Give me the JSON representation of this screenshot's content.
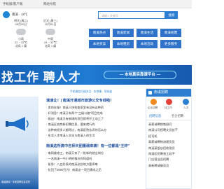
{
  "topbar": {
    "left": "手机版/客户端",
    "nav": "网站导航"
  },
  "header": {
    "city": "南溪 · 18℃",
    "search_placeholder": "请输入关键字",
    "search_button": "搜索"
  },
  "weather": [
    {
      "day": "明天 (周二)",
      "date": "09月30日",
      "cond": "小雨",
      "temp": "22 ~ 32℃",
      "wind": "北风 1 级"
    },
    {
      "day": "后天 (周三)",
      "date": "10月01日",
      "cond": "中雨",
      "temp": "24 ~ 32℃",
      "wind": "北风 1 级"
    }
  ],
  "nav": [
    "南溪热点",
    "南溪新闻",
    "南溪生活",
    "南溪招聘",
    "本地买卖",
    "本地租房",
    "本地活动",
    "更多服务"
  ],
  "banner": {
    "title": "找工作 聘人才",
    "subtitle": "— 本地真实靠谱平台 —"
  },
  "links_bar": "手机微信扫描关注  ·  本地事 · 早知道",
  "promo": {
    "caption": "南溪新闻 · 本地招聘信息发布"
  },
  "news": [
    {
      "title": "速速让！| 南溪开通城市旅游公交专线啦！",
      "items": [
        "· 男的在服！南溪人快检查家里有没有这种药",
        "· 好消息！南溪又有两个“三级公路”项目完成",
        "· 刚出！南溪又有新增的项目即将开工动工了",
        "· 南溪区农商新招聘信息，要来就行的",
        "· 这种病很多人都得过，南溪医院告诉你怎么办",
        "· 东北人才南溪人文化与南溪人的生活"
      ]
    },
    {
      "title": "南溪这所高中名师天团重磅来袭！有一位都是“王炸”",
      "items": [
        "· 电网维修工，南溪又来了一批新的就业岗位",
        "· 一名南溪一中小明的情况你知道吗",
        "· 紧急！八五阶段的南溪这些地方要停电",
        "· 拉回了5000万元！南溪这一项目建成之后"
      ]
    }
  ],
  "right_panel": {
    "title": "南溪招聘",
    "quick": [
      "企业招聘",
      "找工作",
      "人才"
    ],
    "tabs": [
      "招聘信息",
      "名企招聘"
    ],
    "jobs": [
      "高薪诚聘销售顾问",
      "南溪公司招聘文员若干",
      "招司机",
      "高薪诚聘物流理货员",
      "南溪某饭店招收银员",
      "南溪区招聘普工若干",
      "门店营业员招聘",
      "高新聘请服务员"
    ]
  },
  "colors": {
    "brand": "#2c7fd0",
    "nav": "#2e73c9"
  }
}
